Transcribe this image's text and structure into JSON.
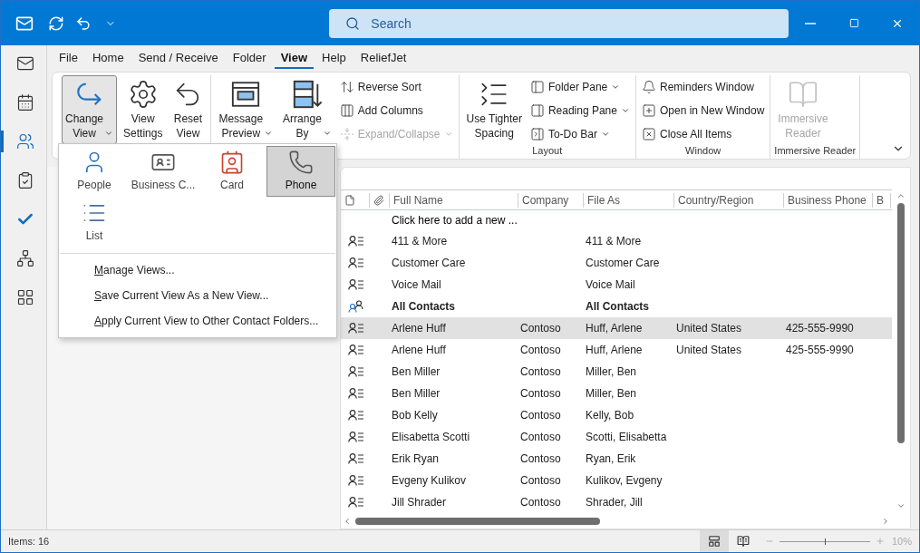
{
  "title_bar": {
    "search": {
      "placeholder": "Search"
    }
  },
  "nav_rail": [
    {
      "selected": false
    },
    {
      "selected": false
    },
    {
      "selected": true
    },
    {
      "selected": false
    },
    {
      "selected": false
    },
    {
      "selected": false
    },
    {
      "selected": false
    }
  ],
  "ribbon": {
    "tabs": [
      {
        "label": "File",
        "selected": false
      },
      {
        "label": "Home",
        "selected": false
      },
      {
        "label": "Send / Receive",
        "selected": false
      },
      {
        "label": "Folder",
        "selected": false
      },
      {
        "label": "View",
        "selected": true
      },
      {
        "label": "Help",
        "selected": false
      },
      {
        "label": "ReliefJet",
        "selected": false
      }
    ],
    "groups": [
      {
        "items": [
          {
            "kind": "large",
            "label": "Change\nView",
            "dropdown": true,
            "pressed": true,
            "disabled": false
          },
          {
            "kind": "large",
            "label": "View\nSettings",
            "dropdown": false,
            "pressed": false,
            "disabled": false
          },
          {
            "kind": "large",
            "label": "Reset\nView",
            "dropdown": false,
            "pressed": false,
            "disabled": false
          }
        ]
      },
      {
        "items": [
          {
            "kind": "large",
            "label": "Message\nPreview",
            "dropdown": true,
            "pressed": false,
            "disabled": false
          },
          {
            "kind": "large",
            "label": "Arrange\nBy",
            "dropdown": true,
            "pressed": false,
            "disabled": false
          },
          {
            "kind": "stack",
            "items": [
              {
                "label": "Reverse Sort",
                "dropdown": false,
                "disabled": false
              },
              {
                "label": "Add Columns",
                "dropdown": false,
                "disabled": false
              },
              {
                "label": "Expand/Collapse",
                "dropdown": true,
                "disabled": true
              }
            ]
          }
        ]
      },
      {
        "label": "Layout",
        "items": [
          {
            "kind": "large",
            "label": "Use Tighter\nSpacing",
            "dropdown": false,
            "pressed": false,
            "disabled": false
          },
          {
            "kind": "stack",
            "items": [
              {
                "label": "Folder Pane",
                "dropdown": true,
                "disabled": false
              },
              {
                "label": "Reading Pane",
                "dropdown": true,
                "disabled": false
              },
              {
                "label": "To-Do Bar",
                "dropdown": true,
                "disabled": false
              }
            ]
          }
        ]
      },
      {
        "label": "Window",
        "items": [
          {
            "kind": "stack",
            "items": [
              {
                "label": "Reminders Window",
                "dropdown": false,
                "disabled": false
              },
              {
                "label": "Open in New Window",
                "dropdown": false,
                "disabled": false
              },
              {
                "label": "Close All Items",
                "dropdown": false,
                "disabled": false
              }
            ]
          }
        ]
      },
      {
        "label": "Immersive Reader",
        "items": [
          {
            "kind": "large",
            "label": "Immersive\nReader",
            "dropdown": false,
            "pressed": false,
            "disabled": true
          }
        ]
      }
    ]
  },
  "change_view_menu": {
    "views": [
      {
        "label": "People",
        "selected": false
      },
      {
        "label": "Business C...",
        "selected": false
      },
      {
        "label": "Card",
        "selected": false
      },
      {
        "label": "Phone",
        "selected": true
      },
      {
        "label": "List",
        "selected": false
      }
    ],
    "commands": [
      "Manage Views...",
      "Save Current View As a New View...",
      "Apply Current View to Other Contact Folders..."
    ]
  },
  "table": {
    "columns": [
      "Full Name",
      "Company",
      "File As",
      "Country/Region",
      "Business Phone",
      "B"
    ],
    "new_row_prompt": "Click here to add a new ...",
    "rows": [
      {
        "kind": "contact",
        "selected": false,
        "full_name": "411 & More",
        "file_as": "411 & More"
      },
      {
        "kind": "contact",
        "selected": false,
        "full_name": "Customer Care",
        "file_as": "Customer Care"
      },
      {
        "kind": "contact",
        "selected": false,
        "full_name": "Voice Mail",
        "file_as": "Voice Mail"
      },
      {
        "kind": "group",
        "selected": false,
        "full_name": "All Contacts",
        "file_as": "All Contacts"
      },
      {
        "kind": "contact",
        "selected": true,
        "full_name": "Arlene Huff",
        "company": "Contoso",
        "file_as": "Huff, Arlene",
        "country_region": "United States",
        "business_phone": "425-555-9990"
      },
      {
        "kind": "contact",
        "selected": false,
        "full_name": "Arlene Huff",
        "company": "Contoso",
        "file_as": "Huff, Arlene",
        "country_region": "United States",
        "business_phone": "425-555-9990"
      },
      {
        "kind": "contact",
        "selected": false,
        "full_name": "Ben Miller",
        "company": "Contoso",
        "file_as": "Miller, Ben"
      },
      {
        "kind": "contact",
        "selected": false,
        "full_name": "Ben Miller",
        "company": "Contoso",
        "file_as": "Miller, Ben"
      },
      {
        "kind": "contact",
        "selected": false,
        "full_name": "Bob Kelly",
        "company": "Contoso",
        "file_as": "Kelly, Bob"
      },
      {
        "kind": "contact",
        "selected": false,
        "full_name": "Elisabetta Scotti",
        "company": "Contoso",
        "file_as": "Scotti, Elisabetta"
      },
      {
        "kind": "contact",
        "selected": false,
        "full_name": "Erik Ryan",
        "company": "Contoso",
        "file_as": "Ryan, Erik"
      },
      {
        "kind": "contact",
        "selected": false,
        "full_name": "Evgeny Kulikov",
        "company": "Contoso",
        "file_as": "Kulikov, Evgeny"
      },
      {
        "kind": "contact",
        "selected": false,
        "full_name": "Jill Shrader",
        "company": "Contoso",
        "file_as": "Shrader, Jill"
      }
    ]
  },
  "status_bar": {
    "items_count": "Items: 16",
    "views": [
      {
        "selected": true
      },
      {
        "selected": false
      }
    ],
    "zoom": {
      "level": 0.5,
      "reading": "10%"
    }
  }
}
